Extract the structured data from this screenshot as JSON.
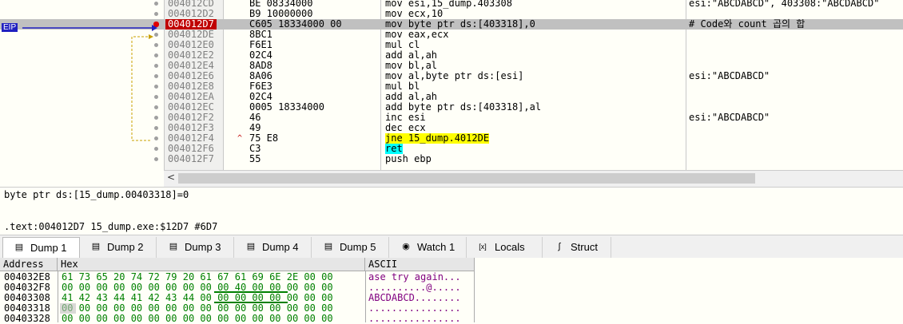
{
  "disasm": {
    "eip_label": "EIP",
    "rows": [
      {
        "addr": "004012CD",
        "bytes": "BE 08334000",
        "asm": "mov esi,15_dump.403308",
        "cmt": "esi:\"ABCDABCD\", 403308:\"ABCDABCD\""
      },
      {
        "addr": "004012D2",
        "bytes": "B9 10000000",
        "asm": "mov ecx,10",
        "cmt": ""
      },
      {
        "addr": "004012D7",
        "bytes": "C605 18334000 00",
        "asm": "mov byte ptr ds:[403318],0",
        "cmt": "# Code와 count 곱의 합"
      },
      {
        "addr": "004012DE",
        "bytes": "8BC1",
        "asm": "mov eax,ecx",
        "cmt": ""
      },
      {
        "addr": "004012E0",
        "bytes": "F6E1",
        "asm": "mul cl",
        "cmt": ""
      },
      {
        "addr": "004012E2",
        "bytes": "02C4",
        "asm": "add al,ah",
        "cmt": ""
      },
      {
        "addr": "004012E4",
        "bytes": "8AD8",
        "asm": "mov bl,al",
        "cmt": ""
      },
      {
        "addr": "004012E6",
        "bytes": "8A06",
        "asm": "mov al,byte ptr ds:[esi]",
        "cmt": "esi:\"ABCDABCD\""
      },
      {
        "addr": "004012E8",
        "bytes": "F6E3",
        "asm": "mul bl",
        "cmt": ""
      },
      {
        "addr": "004012EA",
        "bytes": "02C4",
        "asm": "add al,ah",
        "cmt": ""
      },
      {
        "addr": "004012EC",
        "bytes": "0005 18334000",
        "asm": "add byte ptr ds:[403318],al",
        "cmt": ""
      },
      {
        "addr": "004012F2",
        "bytes": "46",
        "asm": "inc esi",
        "cmt": "esi:\"ABCDABCD\""
      },
      {
        "addr": "004012F3",
        "bytes": "49",
        "asm": "dec ecx",
        "cmt": ""
      },
      {
        "addr": "004012F4",
        "bytes": "75 E8",
        "asm": "jne 15_dump.4012DE",
        "cmt": ""
      },
      {
        "addr": "004012F6",
        "bytes": "C3",
        "asm": "ret",
        "cmt": ""
      },
      {
        "addr": "004012F7",
        "bytes": "55",
        "asm": "push ebp",
        "cmt": ""
      }
    ],
    "jump_arrow": "^"
  },
  "info": {
    "line1": "byte ptr ds:[15_dump.00403318]=0",
    "line2": ".text:004012D7 15_dump.exe:$12D7 #6D7"
  },
  "tabs": [
    {
      "label": "Dump 1",
      "icon": "dump-icon",
      "active": true
    },
    {
      "label": "Dump 2",
      "icon": "dump-icon",
      "active": false
    },
    {
      "label": "Dump 3",
      "icon": "dump-icon",
      "active": false
    },
    {
      "label": "Dump 4",
      "icon": "dump-icon",
      "active": false
    },
    {
      "label": "Dump 5",
      "icon": "dump-icon",
      "active": false
    },
    {
      "label": "Watch 1",
      "icon": "watch-icon",
      "active": false
    },
    {
      "label": "Locals",
      "icon": "locals-icon",
      "active": false
    },
    {
      "label": "Struct",
      "icon": "struct-icon",
      "active": false
    }
  ],
  "dump": {
    "headers": {
      "address": "Address",
      "hex": "Hex",
      "ascii": "ASCII"
    },
    "rows": [
      {
        "addr": "004032E8",
        "hex": "61 73 65 20|74 72 79 20|61 67 61 69|6E 2E 00 00",
        "ascii": "ase try again..."
      },
      {
        "addr": "004032F8",
        "hex": "00 00 00 00|00 00 00 00|00 00 40 00|00 00 00 00",
        "ascii": "..........@....."
      },
      {
        "addr": "00403308",
        "hex": "41 42 43 44|41 42 43 44|00 00 00 00|00 00 00 00",
        "ascii": "ABCDABCD........"
      },
      {
        "addr": "00403318",
        "hex": "00 00 00 00|00 00 00 00|00 00 00 00|00 00 00 00",
        "ascii": "................"
      },
      {
        "addr": "00403328",
        "hex": "00 00 00 00|00 00 00 00|00 00 00 00|00 00 00 00",
        "ascii": "................"
      }
    ]
  }
}
